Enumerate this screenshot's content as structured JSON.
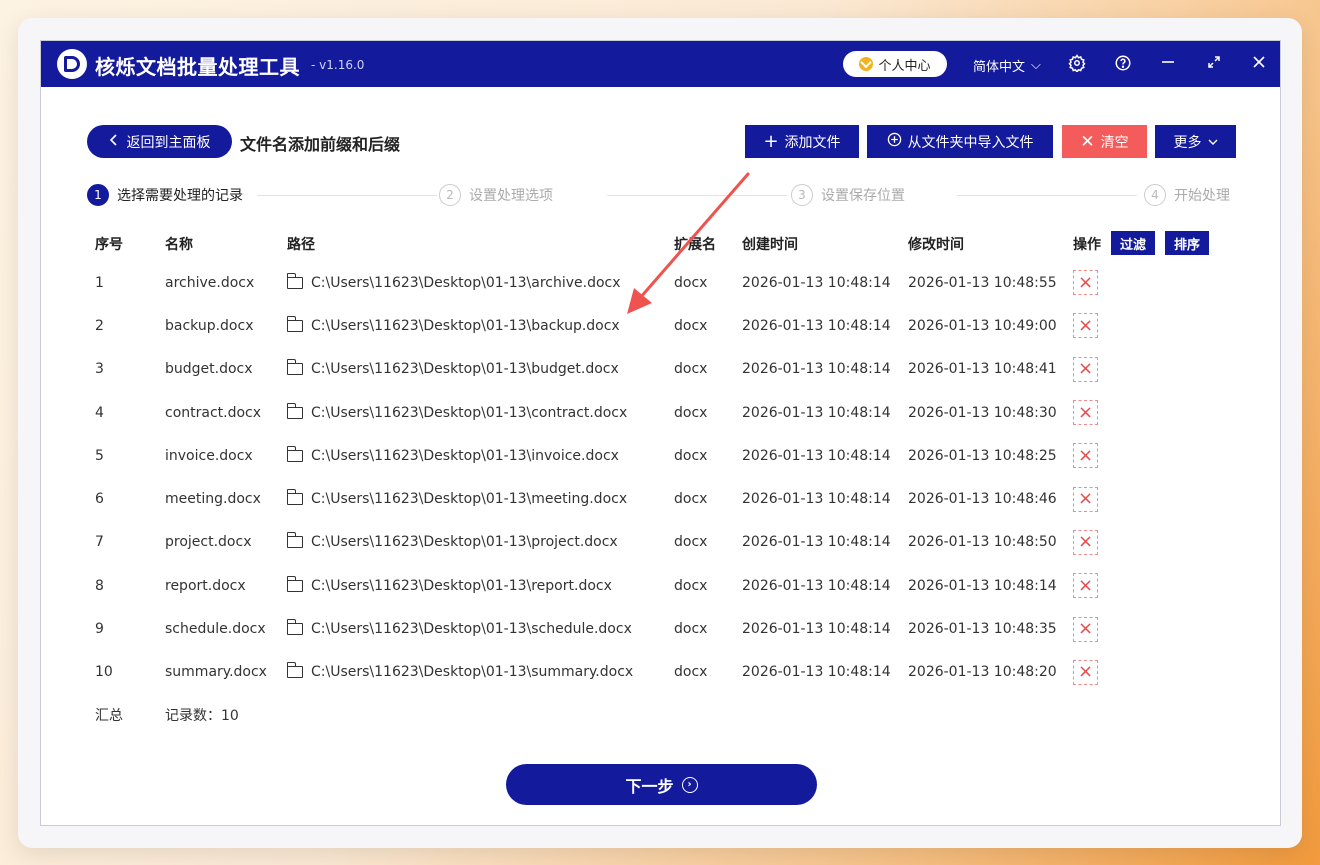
{
  "app": {
    "title": "核烁文档批量处理工具",
    "version": "- v1.16.0",
    "user_center": "个人中心",
    "language": "简体中文"
  },
  "toolbar": {
    "back_label": "返回到主面板",
    "page_title": "文件名添加前缀和后缀",
    "add_file": "添加文件",
    "import_folder": "从文件夹中导入文件",
    "clear": "清空",
    "more": "更多"
  },
  "steps": [
    {
      "num": "1",
      "label": "选择需要处理的记录"
    },
    {
      "num": "2",
      "label": "设置处理选项"
    },
    {
      "num": "3",
      "label": "设置保存位置"
    },
    {
      "num": "4",
      "label": "开始处理"
    }
  ],
  "table": {
    "headers": {
      "no": "序号",
      "name": "名称",
      "path": "路径",
      "ext": "扩展名",
      "created": "创建时间",
      "modified": "修改时间",
      "op": "操作"
    },
    "filter_label": "过滤",
    "sort_label": "排序",
    "rows": [
      {
        "no": "1",
        "name": "archive.docx",
        "path": "C:\\Users\\11623\\Desktop\\01-13\\archive.docx",
        "ext": "docx",
        "created": "2026-01-13 10:48:14",
        "modified": "2026-01-13 10:48:55"
      },
      {
        "no": "2",
        "name": "backup.docx",
        "path": "C:\\Users\\11623\\Desktop\\01-13\\backup.docx",
        "ext": "docx",
        "created": "2026-01-13 10:48:14",
        "modified": "2026-01-13 10:49:00"
      },
      {
        "no": "3",
        "name": "budget.docx",
        "path": "C:\\Users\\11623\\Desktop\\01-13\\budget.docx",
        "ext": "docx",
        "created": "2026-01-13 10:48:14",
        "modified": "2026-01-13 10:48:41"
      },
      {
        "no": "4",
        "name": "contract.docx",
        "path": "C:\\Users\\11623\\Desktop\\01-13\\contract.docx",
        "ext": "docx",
        "created": "2026-01-13 10:48:14",
        "modified": "2026-01-13 10:48:30"
      },
      {
        "no": "5",
        "name": "invoice.docx",
        "path": "C:\\Users\\11623\\Desktop\\01-13\\invoice.docx",
        "ext": "docx",
        "created": "2026-01-13 10:48:14",
        "modified": "2026-01-13 10:48:25"
      },
      {
        "no": "6",
        "name": "meeting.docx",
        "path": "C:\\Users\\11623\\Desktop\\01-13\\meeting.docx",
        "ext": "docx",
        "created": "2026-01-13 10:48:14",
        "modified": "2026-01-13 10:48:46"
      },
      {
        "no": "7",
        "name": "project.docx",
        "path": "C:\\Users\\11623\\Desktop\\01-13\\project.docx",
        "ext": "docx",
        "created": "2026-01-13 10:48:14",
        "modified": "2026-01-13 10:48:50"
      },
      {
        "no": "8",
        "name": "report.docx",
        "path": "C:\\Users\\11623\\Desktop\\01-13\\report.docx",
        "ext": "docx",
        "created": "2026-01-13 10:48:14",
        "modified": "2026-01-13 10:48:14"
      },
      {
        "no": "9",
        "name": "schedule.docx",
        "path": "C:\\Users\\11623\\Desktop\\01-13\\schedule.docx",
        "ext": "docx",
        "created": "2026-01-13 10:48:14",
        "modified": "2026-01-13 10:48:35"
      },
      {
        "no": "10",
        "name": "summary.docx",
        "path": "C:\\Users\\11623\\Desktop\\01-13\\summary.docx",
        "ext": "docx",
        "created": "2026-01-13 10:48:14",
        "modified": "2026-01-13 10:48:20"
      }
    ],
    "summary_label": "汇总",
    "record_count": "记录数：10"
  },
  "next_label": "下一步",
  "colors": {
    "primary": "#141a9c",
    "danger": "#f45b5b",
    "annotation_arrow": "#ef5350"
  }
}
